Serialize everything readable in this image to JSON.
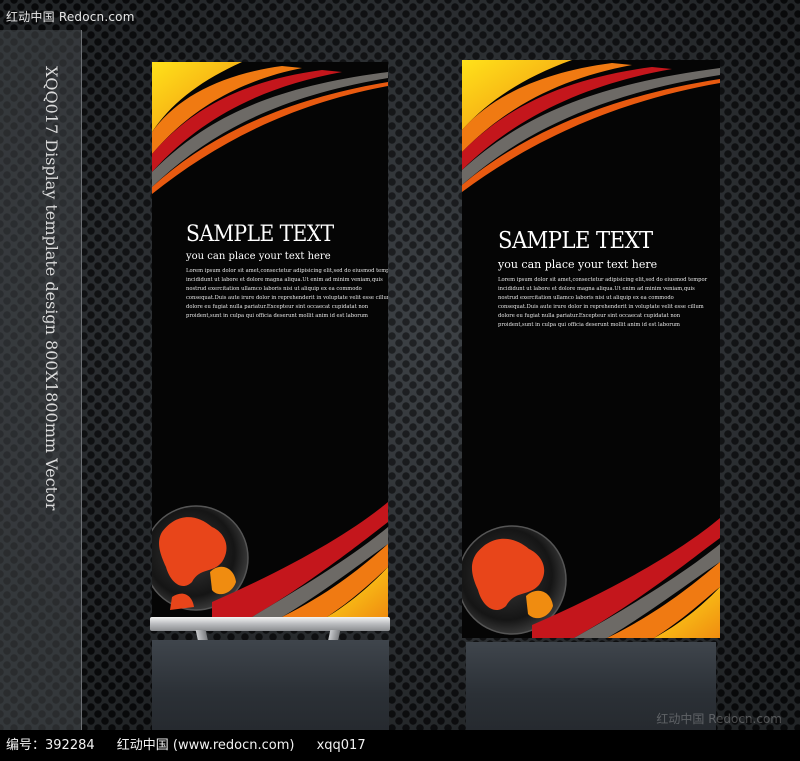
{
  "site_mark": "红动中国 Redocn.com",
  "watermark": "红动中国 Redocn.com",
  "side_text": "XQQ017 Display template design 800X1800mm Vector",
  "banner_left": {
    "title": "SAMPLE TEXT",
    "subtitle": "you can place your text here",
    "body_lines": [
      "Lorem ipsum dolor sit amet,consectetur adipisicing elit,sed do eiusmod tempor",
      "incididunt ut labore et dolore magna aliqua.Ut enim ad minim veniam,quis",
      "nostrud exercitation ullamco laboris nisi ut aliquip ex ea commodo",
      "consequat.Duis aute irure dolor in reprehenderit in voluptate velit esse cillum",
      "dolore eu fugiat nulla pariatur.Excepteur sint occaecat cupidatat non",
      "proident,sunt in culpa qui officia deserunt mollit anim id est laborum"
    ]
  },
  "banner_right": {
    "title": "SAMPLE TEXT",
    "subtitle": "you can place your text here",
    "body_lines": [
      "Lorem ipsum dolor sit amet,consectetur adipisicing elit,sed do eiusmod tempor",
      "incididunt ut labore et dolore magna aliqua.Ut enim ad minim veniam,quis",
      "nostrud exercitation ullamco laboris nisi ut aliquip ex ea commodo",
      "consequat.Duis aute irure dolor in reprehenderit in voluptate velit esse cillum",
      "dolore eu fugiat nulla pariatur.Excepteur sint occaecat cupidatat non",
      "proident,sunt in culpa qui officia deserunt mollit anim id est laborum"
    ]
  },
  "caption": {
    "id_label": "编号：392284",
    "site": "红动中国 (www.redocn.com)",
    "code": "xqq017"
  },
  "colors": {
    "banner_bg": "#050505",
    "swoosh_yellow": "#f6d20a",
    "swoosh_orange": "#f07a12",
    "swoosh_red": "#c4161c",
    "metal_bg": "#33373b"
  }
}
